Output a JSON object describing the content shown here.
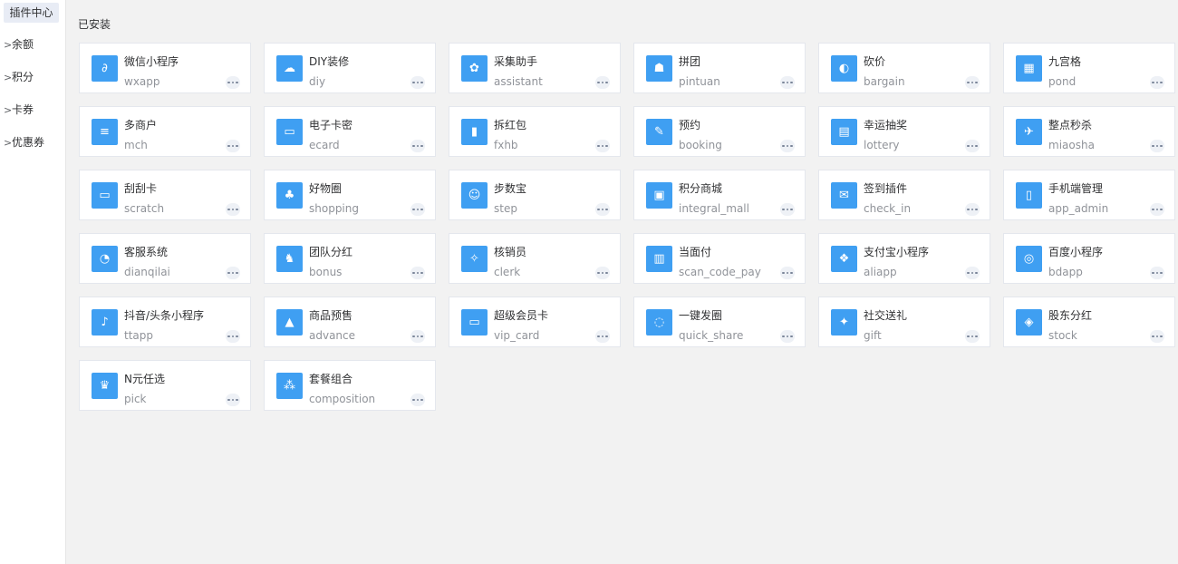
{
  "sidebar": {
    "items": [
      {
        "label": "插件中心",
        "active": true,
        "arrow": ""
      },
      {
        "label": "余额",
        "active": false,
        "arrow": ">"
      },
      {
        "label": "积分",
        "active": false,
        "arrow": ">"
      },
      {
        "label": "卡券",
        "active": false,
        "arrow": ">"
      },
      {
        "label": "优惠券",
        "active": false,
        "arrow": ">"
      }
    ]
  },
  "main": {
    "section_title": "已安装",
    "more_icon": "more-dots-icon",
    "plugins": [
      {
        "name": "微信小程序",
        "key": "wxapp",
        "icon": "wechat-mini-program-icon"
      },
      {
        "name": "DIY装修",
        "key": "diy",
        "icon": "diy-decoration-icon"
      },
      {
        "name": "采集助手",
        "key": "assistant",
        "icon": "collect-assistant-icon"
      },
      {
        "name": "拼团",
        "key": "pintuan",
        "icon": "group-buy-icon"
      },
      {
        "name": "砍价",
        "key": "bargain",
        "icon": "bargain-icon"
      },
      {
        "name": "九宫格",
        "key": "pond",
        "icon": "nine-grid-icon"
      },
      {
        "name": "多商户",
        "key": "mch",
        "icon": "multi-merchant-icon"
      },
      {
        "name": "电子卡密",
        "key": "ecard",
        "icon": "ecard-icon"
      },
      {
        "name": "拆红包",
        "key": "fxhb",
        "icon": "red-packet-icon"
      },
      {
        "name": "预约",
        "key": "booking",
        "icon": "booking-icon"
      },
      {
        "name": "幸运抽奖",
        "key": "lottery",
        "icon": "lottery-icon"
      },
      {
        "name": "整点秒杀",
        "key": "miaosha",
        "icon": "flash-sale-icon"
      },
      {
        "name": "刮刮卡",
        "key": "scratch",
        "icon": "scratch-card-icon"
      },
      {
        "name": "好物圈",
        "key": "shopping",
        "icon": "shopping-circle-icon"
      },
      {
        "name": "步数宝",
        "key": "step",
        "icon": "step-icon"
      },
      {
        "name": "积分商城",
        "key": "integral_mall",
        "icon": "integral-mall-icon"
      },
      {
        "name": "签到插件",
        "key": "check_in",
        "icon": "check-in-icon"
      },
      {
        "name": "手机端管理",
        "key": "app_admin",
        "icon": "mobile-admin-icon"
      },
      {
        "name": "客服系统",
        "key": "dianqilai",
        "icon": "customer-service-icon"
      },
      {
        "name": "团队分红",
        "key": "bonus",
        "icon": "team-bonus-icon"
      },
      {
        "name": "核销员",
        "key": "clerk",
        "icon": "clerk-icon"
      },
      {
        "name": "当面付",
        "key": "scan_code_pay",
        "icon": "scan-pay-icon"
      },
      {
        "name": "支付宝小程序",
        "key": "aliapp",
        "icon": "alipay-icon"
      },
      {
        "name": "百度小程序",
        "key": "bdapp",
        "icon": "baidu-icon"
      },
      {
        "name": "抖音/头条小程序",
        "key": "ttapp",
        "icon": "douyin-icon"
      },
      {
        "name": "商品预售",
        "key": "advance",
        "icon": "presale-icon"
      },
      {
        "name": "超级会员卡",
        "key": "vip_card",
        "icon": "vip-card-icon"
      },
      {
        "name": "一键发圈",
        "key": "quick_share",
        "icon": "quick-share-icon"
      },
      {
        "name": "社交送礼",
        "key": "gift",
        "icon": "gift-icon"
      },
      {
        "name": "股东分红",
        "key": "stock",
        "icon": "stock-icon"
      },
      {
        "name": "N元任选",
        "key": "pick",
        "icon": "pick-icon"
      },
      {
        "name": "套餐组合",
        "key": "composition",
        "icon": "composition-icon"
      }
    ]
  },
  "colors": {
    "icon_bg": "#3f9ff2",
    "page_bg": "#f2f2f2",
    "card_bg": "#ffffff",
    "secondary_text": "#909399"
  }
}
